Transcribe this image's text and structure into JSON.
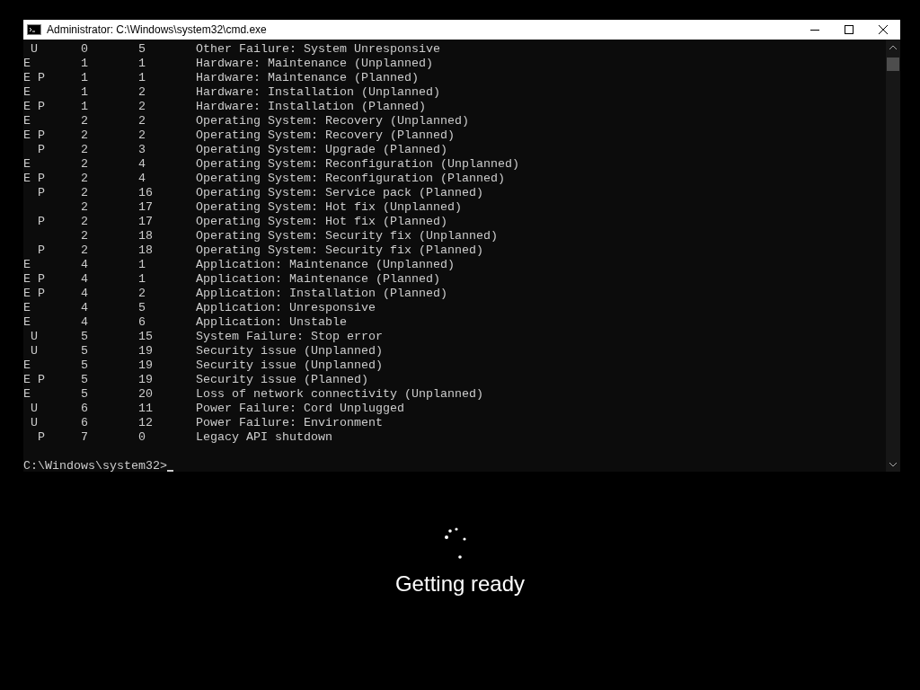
{
  "window": {
    "title": "Administrator: C:\\Windows\\system32\\cmd.exe"
  },
  "rows": [
    {
      "u": "U",
      "major": "0",
      "minor": "5",
      "reason": "Other Failure: System Unresponsive"
    },
    {
      "e": "E",
      "major": "1",
      "minor": "1",
      "reason": "Hardware: Maintenance (Unplanned)"
    },
    {
      "e": "E",
      "p": "P",
      "major": "1",
      "minor": "1",
      "reason": "Hardware: Maintenance (Planned)"
    },
    {
      "e": "E",
      "major": "1",
      "minor": "2",
      "reason": "Hardware: Installation (Unplanned)"
    },
    {
      "e": "E",
      "p": "P",
      "major": "1",
      "minor": "2",
      "reason": "Hardware: Installation (Planned)"
    },
    {
      "e": "E",
      "major": "2",
      "minor": "2",
      "reason": "Operating System: Recovery (Unplanned)"
    },
    {
      "e": "E",
      "p": "P",
      "major": "2",
      "minor": "2",
      "reason": "Operating System: Recovery (Planned)"
    },
    {
      "p": "P",
      "major": "2",
      "minor": "3",
      "reason": "Operating System: Upgrade (Planned)"
    },
    {
      "e": "E",
      "major": "2",
      "minor": "4",
      "reason": "Operating System: Reconfiguration (Unplanned)"
    },
    {
      "e": "E",
      "p": "P",
      "major": "2",
      "minor": "4",
      "reason": "Operating System: Reconfiguration (Planned)"
    },
    {
      "p": "P",
      "major": "2",
      "minor": "16",
      "reason": "Operating System: Service pack (Planned)"
    },
    {
      "major": "2",
      "minor": "17",
      "reason": "Operating System: Hot fix (Unplanned)"
    },
    {
      "p": "P",
      "major": "2",
      "minor": "17",
      "reason": "Operating System: Hot fix (Planned)"
    },
    {
      "major": "2",
      "minor": "18",
      "reason": "Operating System: Security fix (Unplanned)"
    },
    {
      "p": "P",
      "major": "2",
      "minor": "18",
      "reason": "Operating System: Security fix (Planned)"
    },
    {
      "e": "E",
      "major": "4",
      "minor": "1",
      "reason": "Application: Maintenance (Unplanned)"
    },
    {
      "e": "E",
      "p": "P",
      "major": "4",
      "minor": "1",
      "reason": "Application: Maintenance (Planned)"
    },
    {
      "e": "E",
      "p": "P",
      "major": "4",
      "minor": "2",
      "reason": "Application: Installation (Planned)"
    },
    {
      "e": "E",
      "major": "4",
      "minor": "5",
      "reason": "Application: Unresponsive"
    },
    {
      "e": "E",
      "major": "4",
      "minor": "6",
      "reason": "Application: Unstable"
    },
    {
      "u": "U",
      "major": "5",
      "minor": "15",
      "reason": "System Failure: Stop error"
    },
    {
      "u": "U",
      "major": "5",
      "minor": "19",
      "reason": "Security issue (Unplanned)"
    },
    {
      "e": "E",
      "major": "5",
      "minor": "19",
      "reason": "Security issue (Unplanned)"
    },
    {
      "e": "E",
      "p": "P",
      "major": "5",
      "minor": "19",
      "reason": "Security issue (Planned)"
    },
    {
      "e": "E",
      "major": "5",
      "minor": "20",
      "reason": "Loss of network connectivity (Unplanned)"
    },
    {
      "u": "U",
      "major": "6",
      "minor": "11",
      "reason": "Power Failure: Cord Unplugged"
    },
    {
      "u": "U",
      "major": "6",
      "minor": "12",
      "reason": "Power Failure: Environment"
    },
    {
      "p": "P",
      "major": "7",
      "minor": "0",
      "reason": "Legacy API shutdown"
    }
  ],
  "prompt": "C:\\Windows\\system32>",
  "status": "Getting ready"
}
